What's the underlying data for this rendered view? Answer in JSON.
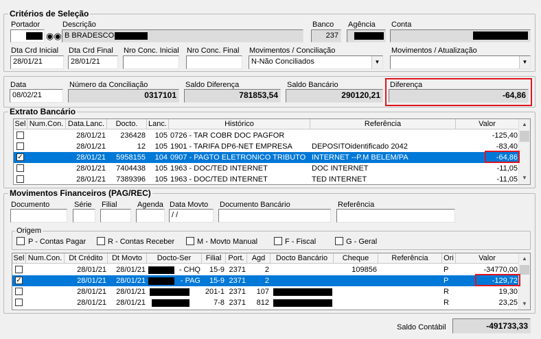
{
  "criterios": {
    "title": "Critérios de Seleção",
    "portador_label": "Portador",
    "descricao_label": "Descrição",
    "descricao_value": "B BRADESCO",
    "banco_label": "Banco",
    "banco_value": "237",
    "agencia_label": "Agência",
    "conta_label": "Conta",
    "dta_crd_inicial_label": "Dta  Crd Inicial",
    "dta_crd_inicial_value": "28/01/21",
    "dta_crd_final_label": "Dta  Crd Final",
    "dta_crd_final_value": "28/01/21",
    "nro_conc_inicial_label": "Nro Conc. Inicial",
    "nro_conc_final_label": "Nro Conc. Final",
    "movimentos_conciliacao_label": "Movimentos / Conciliação",
    "movimentos_conciliacao_value": "N-Não Conciliados",
    "movimentos_atualizacao_label": "Movimentos / Atualização",
    "movimentos_atualizacao_value": ""
  },
  "resumo": {
    "data_label": "Data",
    "data_value": "08/02/21",
    "numero_conciliacao_label": "Número da Conciliação",
    "numero_conciliacao_value": "0317101",
    "saldo_diferenca_label": "Saldo Diferença",
    "saldo_diferenca_value": "781853,54",
    "saldo_bancario_label": "Saldo Bancário",
    "saldo_bancario_value": "290120,21",
    "diferenca_label": "Diferença",
    "diferenca_value": "-64,86"
  },
  "extrato": {
    "title": "Extrato Bancário",
    "columns": [
      "Sel",
      "Num.Con.",
      "Data.Lanc.",
      "Docto.",
      "Lanc.",
      "Histórico",
      "Referência",
      "Valor"
    ],
    "rows": [
      {
        "sel": false,
        "numcon": "",
        "data": "28/01/21",
        "docto": "236428",
        "lanc": "105",
        "historico": "0726 - TAR COBR DOC PAGFOR",
        "referencia": "",
        "valor": "-125,40"
      },
      {
        "sel": false,
        "numcon": "",
        "data": "28/01/21",
        "docto": "12",
        "lanc": "105",
        "historico": "1901 - TARIFA DP6-NET EMPRESA",
        "referencia": "DEPOSITOidentificado   2042",
        "valor": "-83,40"
      },
      {
        "sel": true,
        "numcon": "",
        "data": "28/01/21",
        "docto": "5958155",
        "lanc": "104",
        "historico": "0907 - PAGTO ELETRONICO TRIBUTO",
        "referencia": "INTERNET --P.M BELEM/PA",
        "valor": "-64,86"
      },
      {
        "sel": false,
        "numcon": "",
        "data": "28/01/21",
        "docto": "7404438",
        "lanc": "105",
        "historico": "1963 - DOC/TED INTERNET",
        "referencia": "DOC INTERNET",
        "valor": "-11,05"
      },
      {
        "sel": false,
        "numcon": "",
        "data": "28/01/21",
        "docto": "7389396",
        "lanc": "105",
        "historico": "1963 - DOC/TED INTERNET",
        "referencia": "TED INTERNET",
        "valor": "-11,05"
      }
    ]
  },
  "movimentos": {
    "title": "Movimentos Financeiros (PAG/REC)",
    "documento_label": "Documento",
    "serie_label": "Série",
    "filial_label": "Filial",
    "agenda_label": "Agenda",
    "data_movto_label": "Data Movto",
    "data_movto_value": " / /",
    "documento_bancario_label": "Documento Bancário",
    "referencia_label": "Referência",
    "origem_title": "Origem",
    "origem_options": [
      "P - Contas Pagar",
      "R - Contas Receber",
      "M - Movto Manual",
      "F - Fiscal",
      "G - Geral"
    ],
    "columns": [
      "Sel",
      "Num.Con.",
      "Dt Crédito",
      "Dt Movto",
      "Docto-Ser",
      "Filial",
      "Port.",
      "Agd",
      "Docto Bancário",
      "Cheque",
      "Referência",
      "Ori",
      "Valor"
    ],
    "rows": [
      {
        "sel": false,
        "dtcredito": "28/01/21",
        "dtmovto": "28/01/21",
        "doctoser": "- CHQ",
        "filial": "15-9",
        "port": "2371",
        "agd": "2",
        "doctobancario": "",
        "cheque": "109856",
        "referencia": "",
        "ori": "P",
        "valor": "-34770,00"
      },
      {
        "sel": true,
        "dtcredito": "28/01/21",
        "dtmovto": "28/01/21",
        "doctoser": "- PAG",
        "filial": "15-9",
        "port": "2371",
        "agd": "2",
        "doctobancario": "",
        "cheque": "",
        "referencia": "",
        "ori": "P",
        "valor": "-129,72"
      },
      {
        "sel": false,
        "dtcredito": "28/01/21",
        "dtmovto": "28/01/21",
        "doctoser": "",
        "filial": "201-1",
        "port": "2371",
        "agd": "107",
        "doctobancario": "",
        "cheque": "",
        "referencia": "",
        "ori": "R",
        "valor": "19,30"
      },
      {
        "sel": false,
        "dtcredito": "28/01/21",
        "dtmovto": "28/01/21",
        "doctoser": "",
        "filial": "7-8",
        "port": "2371",
        "agd": "812",
        "doctobancario": "",
        "cheque": "",
        "referencia": "",
        "ori": "R",
        "valor": "23,25"
      },
      {
        "sel": false,
        "dtcredito": "28/01/21",
        "dtmovto": "28/01/21",
        "doctoser": "",
        "filial": "201-1",
        "port": "2371",
        "agd": "137",
        "doctobancario": "",
        "cheque": "",
        "referencia": "",
        "ori": "R",
        "valor": "36,67"
      }
    ]
  },
  "footer": {
    "saldo_contabil_label": "Saldo Contábil",
    "saldo_contabil_value": "-491733,33"
  },
  "colors": {
    "selection": "#0078d7",
    "highlight_box": "#e0141e",
    "readonly_field": "#dcdcdc"
  }
}
